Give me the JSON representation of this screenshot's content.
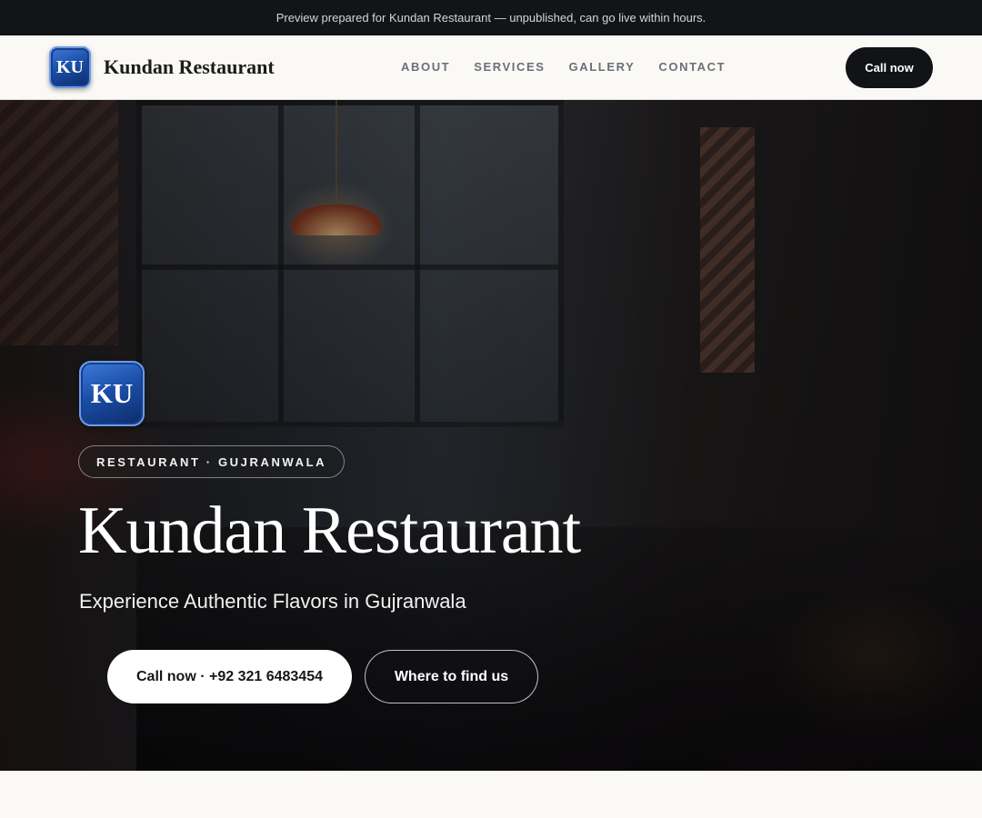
{
  "topbar": {
    "notice": "Preview prepared for Kundan Restaurant — unpublished, can go live within hours."
  },
  "nav": {
    "logo_text": "KU",
    "brand": "Kundan Restaurant",
    "links": [
      "ABOUT",
      "SERVICES",
      "GALLERY",
      "CONTACT"
    ],
    "call_label": "Call now"
  },
  "hero": {
    "logo_text": "KU",
    "category": "RESTAURANT · GUJRANWALA",
    "title": "Kundan Restaurant",
    "tagline": "Experience Authentic Flavors in Gujranwala",
    "primary_cta": "Call now · +92 321 6483454",
    "secondary_cta": "Where to find us"
  },
  "colors": {
    "dark": "#121418",
    "nav_background": "#faf9f6",
    "badge_blue": "#1c4fa8"
  }
}
